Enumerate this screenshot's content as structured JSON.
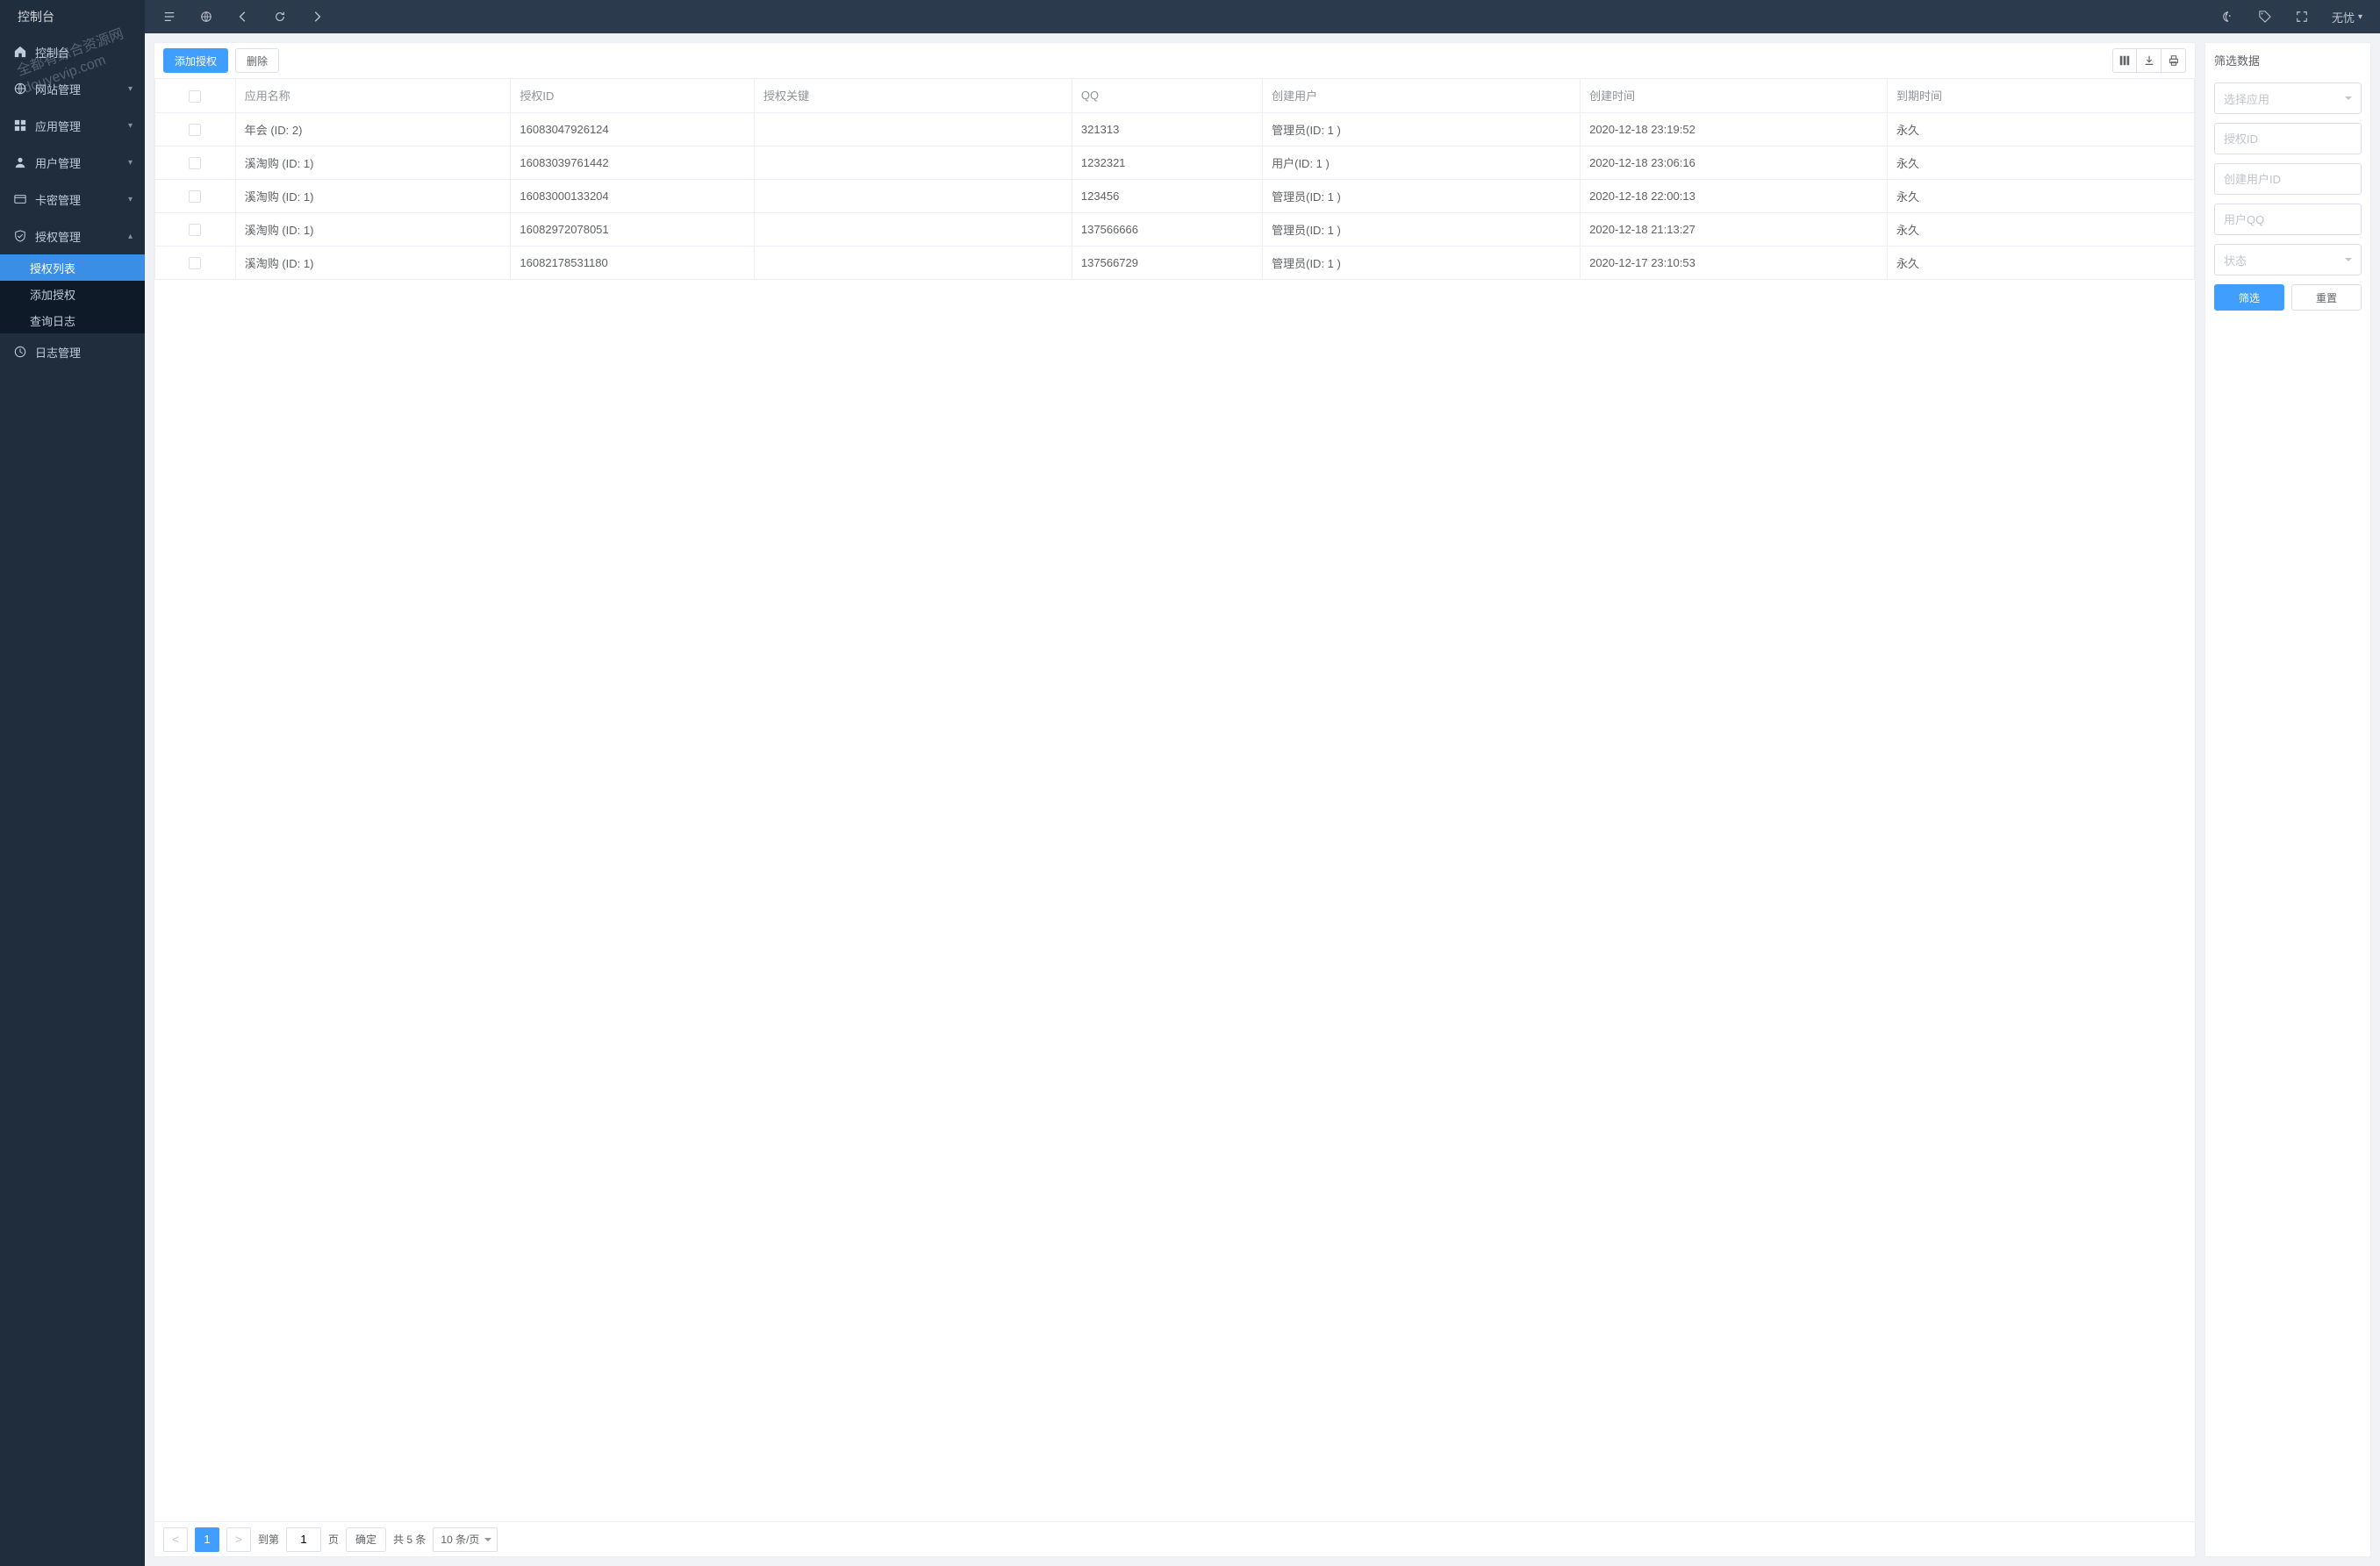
{
  "sidebar": {
    "title": "控制台",
    "items": [
      {
        "label": "控制台",
        "icon": "home"
      },
      {
        "label": "网站管理",
        "icon": "globe",
        "arrow": "down"
      },
      {
        "label": "应用管理",
        "icon": "grid",
        "arrow": "down"
      },
      {
        "label": "用户管理",
        "icon": "user",
        "arrow": "down"
      },
      {
        "label": "卡密管理",
        "icon": "card",
        "arrow": "down"
      },
      {
        "label": "授权管理",
        "icon": "shield",
        "arrow": "up",
        "children": [
          "授权列表",
          "添加授权",
          "查询日志"
        ]
      },
      {
        "label": "日志管理",
        "icon": "clock"
      }
    ]
  },
  "topbar": {
    "user": "无忧"
  },
  "toolbar": {
    "add": "添加授权",
    "delete": "删除"
  },
  "table": {
    "headers": [
      "应用名称",
      "授权ID",
      "授权关键",
      "QQ",
      "创建用户",
      "创建时间",
      "到期时间"
    ],
    "rows": [
      {
        "app": "年会 (ID: 2)",
        "id": "16083047926124",
        "key": "",
        "qq": "321313",
        "creator": "管理员(ID: 1 )",
        "created": "2020-12-18 23:19:52",
        "expire": "永久"
      },
      {
        "app": "溪淘购 (ID: 1)",
        "id": "16083039761442",
        "key": "",
        "qq": "1232321",
        "creator": "用户(ID: 1 )",
        "created": "2020-12-18 23:06:16",
        "expire": "永久"
      },
      {
        "app": "溪淘购 (ID: 1)",
        "id": "16083000133204",
        "key": "",
        "qq": "123456",
        "creator": "管理员(ID: 1 )",
        "created": "2020-12-18 22:00:13",
        "expire": "永久"
      },
      {
        "app": "溪淘购 (ID: 1)",
        "id": "16082972078051",
        "key": "",
        "qq": "137566666",
        "creator": "管理员(ID: 1 )",
        "created": "2020-12-18 21:13:27",
        "expire": "永久"
      },
      {
        "app": "溪淘购 (ID: 1)",
        "id": "16082178531180",
        "key": "",
        "qq": "137566729",
        "creator": "管理员(ID: 1 )",
        "created": "2020-12-17 23:10:53",
        "expire": "永久"
      }
    ]
  },
  "pager": {
    "goto_label": "到第",
    "page_suffix": "页",
    "confirm": "确定",
    "total": "共 5 条",
    "pagesize": "10 条/页",
    "page_input": "1",
    "current": "1"
  },
  "filter": {
    "title": "筛选数据",
    "select_app": "选择应用",
    "auth_id_ph": "授权ID",
    "creator_id_ph": "创建用户ID",
    "user_qq_ph": "用户QQ",
    "status_ph": "状态",
    "filter_btn": "筛选",
    "reset_btn": "重置"
  },
  "watermark": {
    "line1": "全都有综合资源网",
    "line2": "douyevip.com"
  }
}
